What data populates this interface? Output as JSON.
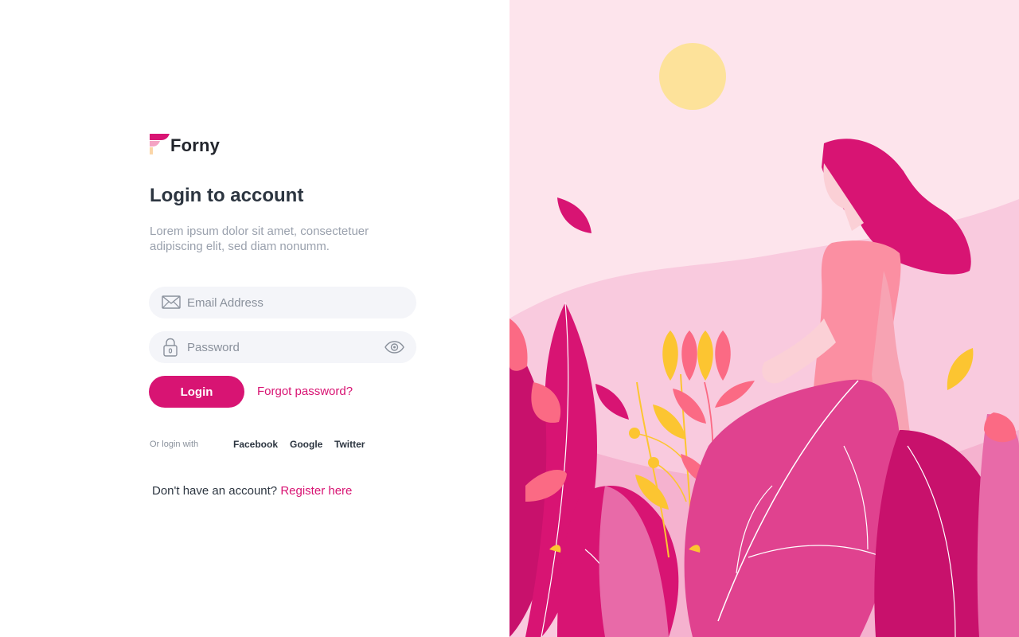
{
  "brand": {
    "name": "Forny",
    "accent": "#d81473"
  },
  "heading": {
    "title": "Login to account",
    "subtitle": "Lorem ipsum dolor sit amet, consectetuer adipiscing elit, sed diam nonumm."
  },
  "form": {
    "email": {
      "placeholder": "Email Address",
      "value": "",
      "icon": "envelope-icon"
    },
    "password": {
      "placeholder": "Password",
      "value": "",
      "icon": "lock-icon",
      "toggle_icon": "eye-icon"
    },
    "login_label": "Login",
    "forgot_label": "Forgot password?"
  },
  "social": {
    "prefix": "Or login with",
    "providers": [
      "Facebook",
      "Google",
      "Twitter"
    ]
  },
  "register": {
    "prompt": "Don't have an account?",
    "link": "Register here"
  },
  "colors": {
    "background_panel": "#fde4ec",
    "input_bg": "#f4f5f9",
    "text_dark": "#2c3540",
    "text_muted": "#9aa1ad"
  }
}
